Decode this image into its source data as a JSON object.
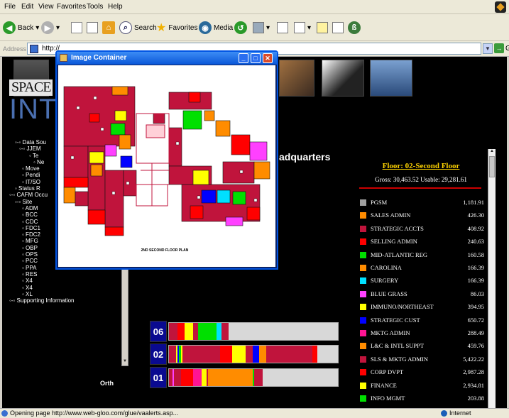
{
  "menu": [
    "File",
    "Edit",
    "View",
    "Favorites",
    "Tools",
    "Help"
  ],
  "toolbar": {
    "back": "Back",
    "search": "Search",
    "favorites": "Favorites",
    "media": "Media"
  },
  "address": {
    "label": "Address",
    "url": "http://",
    "go": "Go"
  },
  "header": {
    "space": "SPACE",
    "inte": "INTE"
  },
  "tree": [
    "◦-◦ Data Sou",
    "◦-◦ JJEM",
    "◦ Te",
    "◦ Ne",
    "◦ Move",
    "◦ Pendi",
    "◦ IT/SO",
    "◦ Status R",
    "◦-◦ CAFM Occu",
    "◦-◦ Site",
    "◦ ADM",
    "◦ BCC",
    "◦ CDC",
    "◦ FDC1",
    "◦ FDC2",
    "◦ MFG",
    "◦ OBP",
    "◦ OPS",
    "◦ PCC",
    "◦ PPA",
    "◦ RES",
    "◦ X4",
    "◦ X4",
    "◦ XL",
    "◦-◦ Supporting Information"
  ],
  "orth": "Orth",
  "hq_title": "adquarters",
  "legend": {
    "floor_title": "Floor: 02-Second Floor",
    "stats": "Gross: 30,463.52  Usable: 29,281.61",
    "items": [
      {
        "name": "PGSM",
        "value": "1,181.91",
        "color": "#a0a0a0"
      },
      {
        "name": "SALES ADMIN",
        "value": "426.30",
        "color": "#ff8c00"
      },
      {
        "name": "STRATEGIC ACCTS",
        "value": "408.92",
        "color": "#c0143c"
      },
      {
        "name": "SELLING ADMIN",
        "value": "240.63",
        "color": "#ff0000"
      },
      {
        "name": "MID-ATLANTIC REG",
        "value": "160.58",
        "color": "#00e000"
      },
      {
        "name": "CAROLINA",
        "value": "166.39",
        "color": "#ff8c00"
      },
      {
        "name": "SURGERY",
        "value": "166.39",
        "color": "#00e0ff"
      },
      {
        "name": "BLUE GRASS",
        "value": "86.03",
        "color": "#ff40ff"
      },
      {
        "name": "IMMUNO/NORTHEAST",
        "value": "394.95",
        "color": "#ffff00"
      },
      {
        "name": "STRATEGIC CUST",
        "value": "650.72",
        "color": "#0000ff"
      },
      {
        "name": "MKTG ADMIN",
        "value": "288.49",
        "color": "#ff1493"
      },
      {
        "name": "L&C & INTL SUPPT",
        "value": "459.76",
        "color": "#ff8c00"
      },
      {
        "name": "SLS & MKTG ADMIN",
        "value": "5,422.22",
        "color": "#c0143c"
      },
      {
        "name": "CORP DVPT",
        "value": "2,987.28",
        "color": "#ff0000"
      },
      {
        "name": "FINANCE",
        "value": "2,934.81",
        "color": "#ffff00"
      },
      {
        "name": "INFO MGMT",
        "value": "203.88",
        "color": "#00e000"
      }
    ]
  },
  "floors": [
    {
      "num": "06",
      "fill": 0.35,
      "segments": [
        [
          "#c0143c",
          0.05
        ],
        [
          "#ff0000",
          0.04
        ],
        [
          "#ffff00",
          0.05
        ],
        [
          "#c0143c",
          0.03
        ],
        [
          "#00e000",
          0.11
        ],
        [
          "#00e0ff",
          0.03
        ],
        [
          "#c0143c",
          0.04
        ]
      ]
    },
    {
      "num": "02",
      "fill": 0.87,
      "segments": [
        [
          "#c0143c",
          0.04
        ],
        [
          "#ffff00",
          0.01
        ],
        [
          "#0000ff",
          0.01
        ],
        [
          "#00e000",
          0.01
        ],
        [
          "#ffff00",
          0.01
        ],
        [
          "#c0143c",
          0.22
        ],
        [
          "#ff0000",
          0.07
        ],
        [
          "#ffff00",
          0.08
        ],
        [
          "#c0143c",
          0.04
        ],
        [
          "#0000ff",
          0.04
        ],
        [
          "#ff8c00",
          0.04
        ],
        [
          "#c0143c",
          0.27
        ],
        [
          "#ff0000",
          0.03
        ]
      ]
    },
    {
      "num": "01",
      "fill": 0.55,
      "segments": [
        [
          "#c0143c",
          0.02
        ],
        [
          "#ff40ff",
          0.01
        ],
        [
          "#c0143c",
          0.04
        ],
        [
          "#ff0000",
          0.07
        ],
        [
          "#ff1493",
          0.05
        ],
        [
          "#ffff00",
          0.03
        ],
        [
          "#c0143c",
          0.01
        ],
        [
          "#ff8c00",
          0.26
        ],
        [
          "#00e000",
          0.01
        ],
        [
          "#c0143c",
          0.05
        ]
      ]
    }
  ],
  "popup": {
    "title": "Image Container",
    "caption": "2ND SECOND FLOOR PLAN"
  },
  "status": {
    "text": "Opening page http://www.web-gloo.com/glue/vaalerts.asp...",
    "zone": "Internet"
  }
}
